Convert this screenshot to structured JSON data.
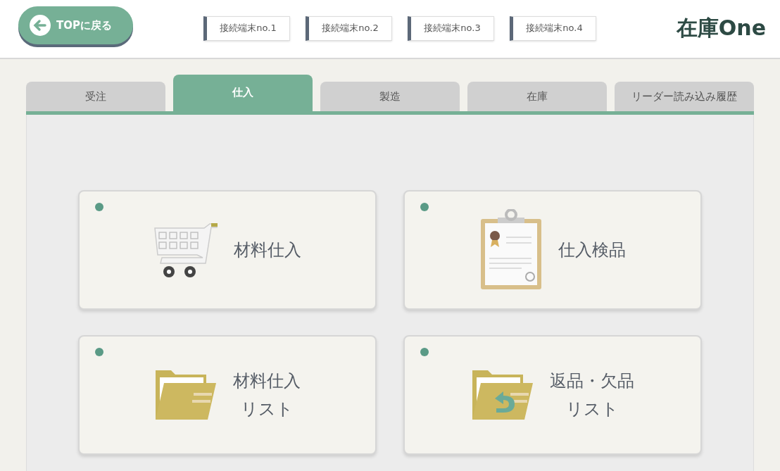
{
  "header": {
    "back_button": "TOPに戻る",
    "terminals": [
      "接続端末no.1",
      "接続端末no.2",
      "接続端末no.3",
      "接続端末no.4"
    ],
    "logo": "在庫One"
  },
  "tabs": [
    {
      "label": "受注",
      "selected": false
    },
    {
      "label": "仕入",
      "selected": true
    },
    {
      "label": "製造",
      "selected": false
    },
    {
      "label": "在庫",
      "selected": false
    },
    {
      "label": "リーダー読み込み履歴",
      "selected": false
    }
  ],
  "tiles": [
    {
      "kind": "cart",
      "lines": [
        "材料仕入"
      ]
    },
    {
      "kind": "clipboard",
      "lines": [
        "仕入検品"
      ]
    },
    {
      "kind": "folder",
      "lines": [
        "材料仕入",
        "リスト"
      ]
    },
    {
      "kind": "folder-return",
      "lines": [
        "返品・欠品",
        "リスト"
      ]
    }
  ]
}
